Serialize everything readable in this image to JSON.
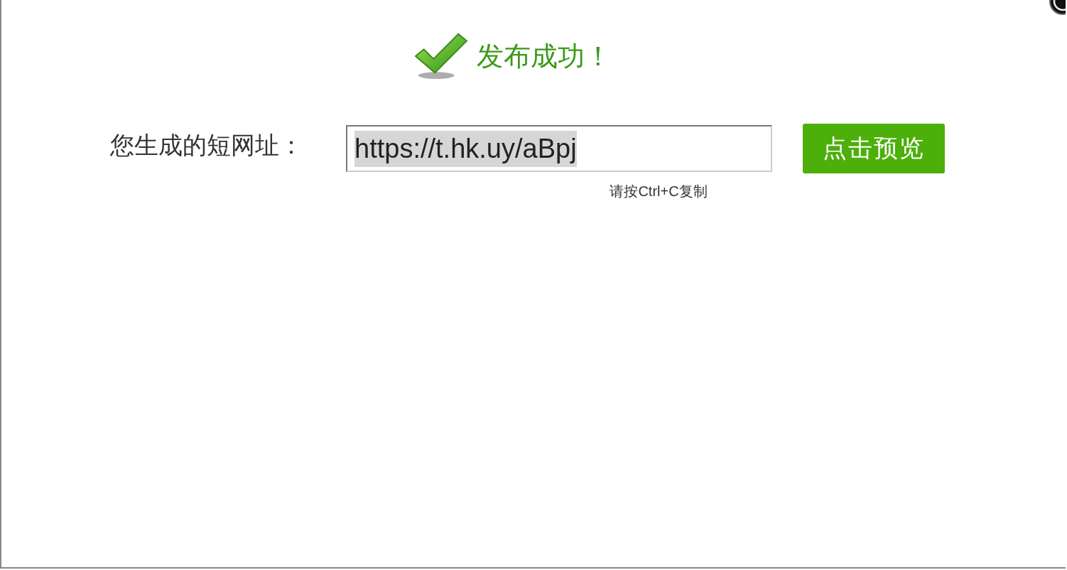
{
  "dialog": {
    "title": "发布成功！",
    "close_button": true
  },
  "short_url": {
    "label": "您生成的短网址：",
    "value": "https://t.hk.uy/aBpj",
    "text_selected": true,
    "hint": "请按Ctrl+C复制"
  },
  "preview_button": {
    "label": "点击预览"
  }
}
